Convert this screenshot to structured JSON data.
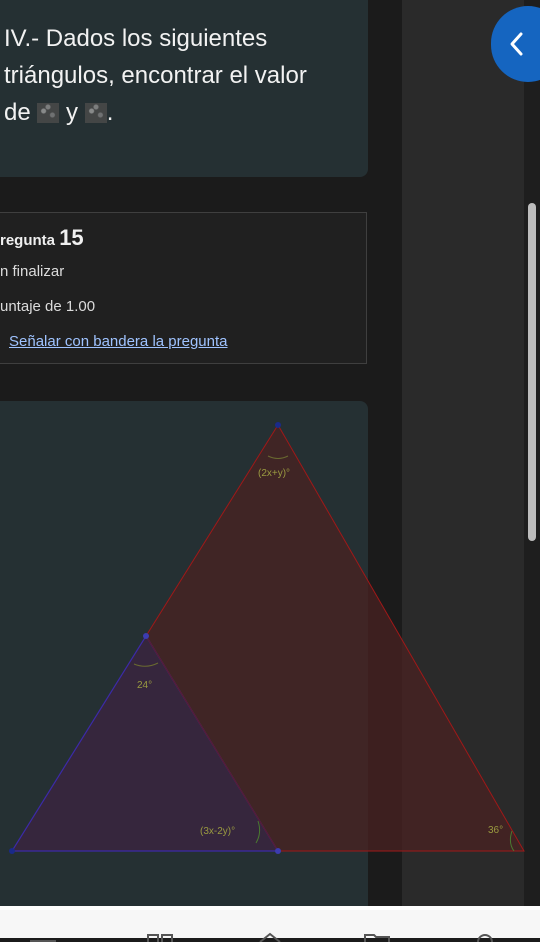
{
  "question": {
    "line1": "IV.- Dados los siguientes",
    "line2": "triángulos, encontrar el valor",
    "line3_prefix": "de ",
    "line3_join": " y ",
    "line3_suffix": "."
  },
  "info": {
    "title_partial": "regunta",
    "number": "15",
    "status_partial": "n finalizar",
    "score_partial": "untaje de 1.00",
    "flag_link": "Señalar con bandera la pregunta"
  },
  "figure": {
    "label_top_angle": "(2x+y)°",
    "label_left_angle": "24°",
    "label_bottom_angle": "(3x-2y)°",
    "label_right_angle": "36°"
  },
  "colors": {
    "card_bg": "#253033",
    "accent_button": "#1565c0",
    "link": "#9fc3ff",
    "big_triangle_stroke": "#a01818",
    "small_triangle_stroke": "#3c2aa8",
    "angle_label": "#9a9a40"
  },
  "icons": {
    "back_button": "chevron-left-icon",
    "flag": "flag-icon"
  }
}
